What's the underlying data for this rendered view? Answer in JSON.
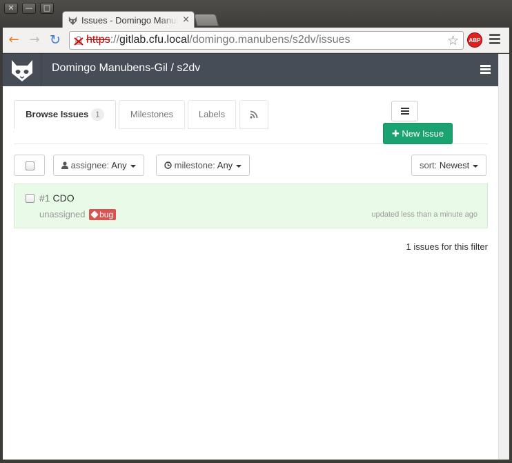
{
  "window": {
    "close_glyph": "✕",
    "minimize_glyph": "—",
    "maximize_glyph": "□"
  },
  "browser": {
    "tab_title": "Issues - Domingo Manubens-Gil / s2dv",
    "tab_close_glyph": "×",
    "url_scheme": "https",
    "url_sep": "://",
    "url_host": "gitlab.cfu.local",
    "url_path": "/domingo.manubens/s2dv/issues",
    "abp_label": "ABP",
    "back_glyph": "←",
    "forward_glyph": "→",
    "reload_glyph": "↻",
    "star_glyph": "☆"
  },
  "header": {
    "title": "Domingo Manubens-Gil / s2dv"
  },
  "tabs": [
    {
      "label": "Browse Issues",
      "badge": "1"
    },
    {
      "label": "Milestones"
    },
    {
      "label": "Labels"
    },
    {
      "icon": "rss-icon"
    }
  ],
  "actions": {
    "new_issue_label": "New Issue",
    "new_issue_glyph": "✚",
    "new_issue_color": "#1aa36e"
  },
  "filters": {
    "assignee_label": "assignee:",
    "assignee_value": "Any",
    "milestone_label": "milestone:",
    "milestone_value": "Any",
    "sort_label": "sort:",
    "sort_value": "Newest"
  },
  "issues": [
    {
      "number": "#1",
      "title": "CDO",
      "assignee": "unassigned",
      "labels": [
        "bug"
      ],
      "updated": "updated less than a minute ago"
    }
  ],
  "footer": {
    "count_text": "1 issues for this filter"
  },
  "colors": {
    "header_bg": "#474d57",
    "issue_row_bg": "#e9fbe8",
    "bug_label": "#d9534f"
  }
}
